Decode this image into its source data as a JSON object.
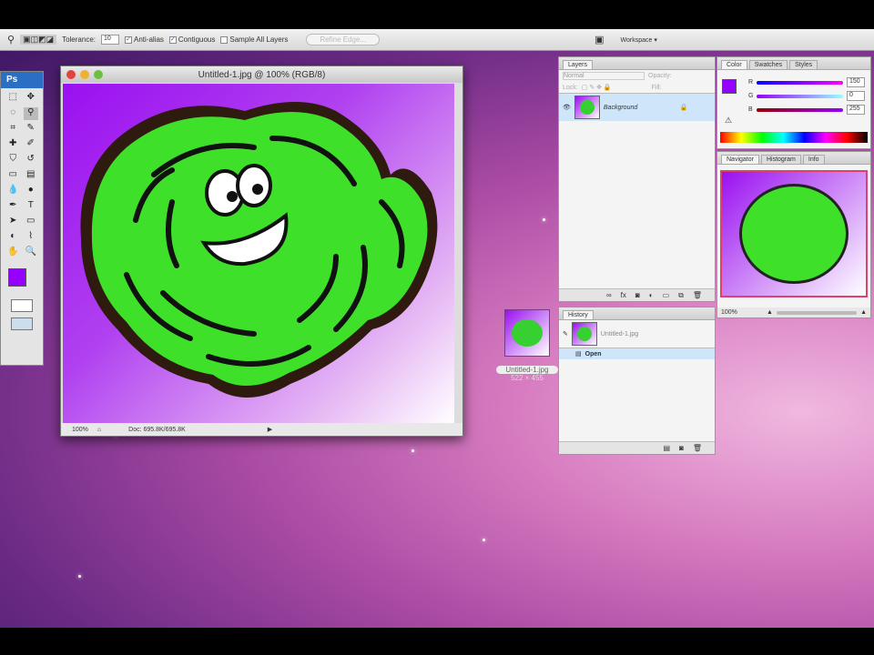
{
  "options_bar": {
    "tolerance_label": "Tolerance:",
    "tolerance_value": "10",
    "anti_alias": "Anti-alias",
    "contiguous": "Contiguous",
    "sample_all": "Sample All Layers",
    "refine_edge": "Refine Edge...",
    "workspace": "Workspace ▾"
  },
  "tools": {
    "logo": "Ps"
  },
  "document": {
    "title": "Untitled-1.jpg @ 100% (RGB/8)",
    "zoom": "100%",
    "doc_size": "Doc: 695.8K/695.8K"
  },
  "layers": {
    "tab": "Layers",
    "blend_mode": "Normal",
    "opacity_label": "Opacity:",
    "lock_label": "Lock:",
    "fill_label": "Fill:",
    "layer_name": "Background"
  },
  "color": {
    "tabs": [
      "Color",
      "Swatches",
      "Styles"
    ],
    "r_label": "R",
    "g_label": "G",
    "b_label": "B",
    "r": "150",
    "g": "0",
    "b": "255",
    "fg": "#9600ff"
  },
  "navigator": {
    "tabs": [
      "Navigator",
      "Histogram",
      "Info"
    ],
    "zoom": "100%"
  },
  "history": {
    "tab": "History",
    "snapshot": "Untitled-1.jpg",
    "step": "Open"
  },
  "desktop_icon": {
    "name": "Untitled-1.jpg",
    "dims": "522 × 455"
  }
}
